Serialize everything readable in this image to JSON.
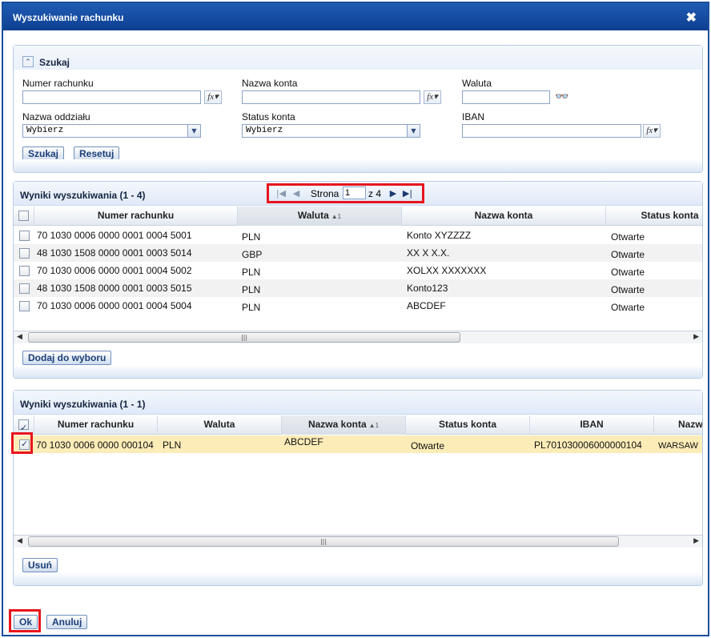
{
  "dialog": {
    "title": "Wyszukiwanie rachunku",
    "close_icon": "close-icon"
  },
  "search": {
    "title": "Szukaj",
    "fields": {
      "numer_rachunku": {
        "label": "Numer rachunku",
        "value": ""
      },
      "nazwa_konta": {
        "label": "Nazwa konta",
        "value": ""
      },
      "waluta": {
        "label": "Waluta",
        "value": ""
      },
      "nazwa_oddzialu": {
        "label": "Nazwa oddziału",
        "value": "Wybierz"
      },
      "status_konta": {
        "label": "Status konta",
        "value": "Wybierz"
      },
      "iban": {
        "label": "IBAN",
        "value": ""
      }
    },
    "fx_label": "fx",
    "search_button": "Szukaj",
    "reset_button": "Resetuj"
  },
  "results": {
    "title": "Wyniki wyszukiwania (1 - 4)",
    "pager": {
      "page_label": "Strona",
      "page_value": "1",
      "of_label": "z 4"
    },
    "columns": [
      "Numer rachunku",
      "Waluta",
      "Nazwa konta",
      "Status konta"
    ],
    "sort_indicator": "▲1",
    "rows": [
      {
        "account": "70 1030 0006 0000 0001 0004 5001",
        "currency": "PLN",
        "name": "Konto XYZZZZ",
        "status": "Otwarte"
      },
      {
        "account": "48 1030 1508 0000 0001 0003 5014",
        "currency": "GBP",
        "name": "XX X X.X.",
        "status": "Otwarte"
      },
      {
        "account": "70 1030 0006 0000 0001 0004 5002",
        "currency": "PLN",
        "name": "XOLXX XXXXXXX",
        "status": "Otwarte"
      },
      {
        "account": "48 1030 1508 0000 0001 0003 5015",
        "currency": "PLN",
        "name": "Konto123",
        "status": "Otwarte"
      },
      {
        "account": "70 1030 0006 0000 0001 0004 5004",
        "currency": "PLN",
        "name": "ABCDEF",
        "status": "Otwarte"
      }
    ],
    "add_button": "Dodaj do wyboru"
  },
  "selected": {
    "title": "Wyniki wyszukiwania (1 - 1)",
    "columns": [
      "Numer rachunku",
      "Waluta",
      "Nazwa konta",
      "Status konta",
      "IBAN",
      "Nazw"
    ],
    "sort_indicator": "▲1",
    "rows": [
      {
        "account": "70 1030 0006 0000 000104",
        "currency": "PLN",
        "name": "ABCDEF",
        "status": "Otwarte",
        "iban": "PL701030006000000104",
        "branch": "WARSAW"
      }
    ],
    "remove_button": "Usuń"
  },
  "footer": {
    "ok_button": "Ok",
    "cancel_button": "Anuluj"
  },
  "colors": {
    "titlebar": "#1a4f9c",
    "highlight": "#e8141e",
    "selected_row": "#fcecb8"
  }
}
